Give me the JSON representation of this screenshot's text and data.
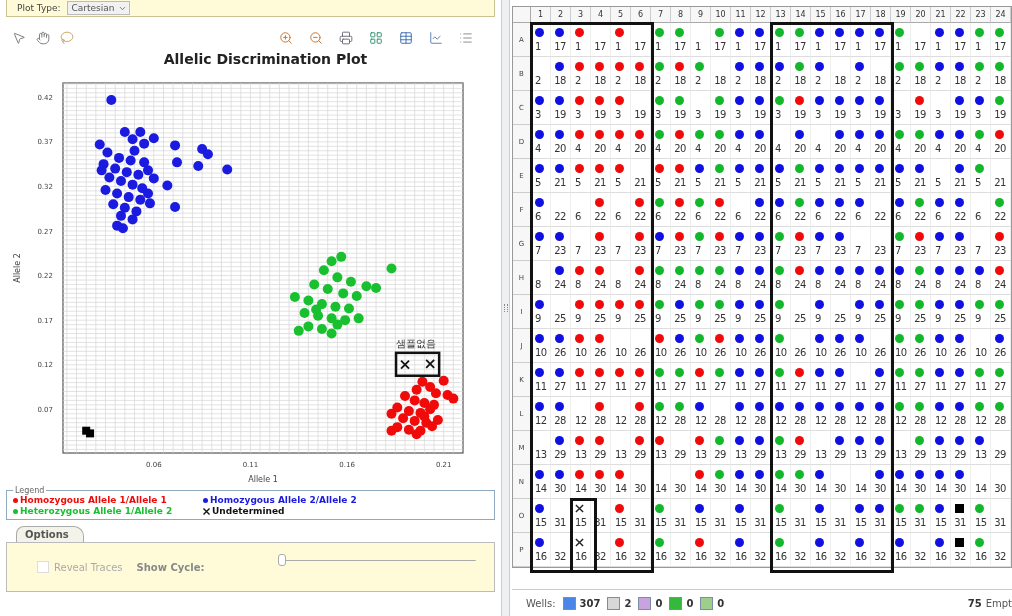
{
  "plot_type": {
    "label": "Plot Type:",
    "value": "Cartesian"
  },
  "plot": {
    "title": "Allelic Discrimination Plot",
    "chart_data": {
      "type": "scatter",
      "grid": true,
      "xlabel": "Allele 1",
      "ylabel": "Allele 2",
      "xlim": [
        0.013,
        0.22
      ],
      "ylim": [
        0.021,
        0.436
      ],
      "xticks": [
        0.06,
        0.11,
        0.16,
        0.21
      ],
      "yticks": [
        0.07,
        0.12,
        0.17,
        0.22,
        0.27,
        0.32,
        0.37,
        0.42
      ],
      "series": [
        {
          "name": "Homozygous Allele 1/Allele 1",
          "color": "#f00a0a",
          "marker": "circle",
          "x": [
            0.199,
            0.203,
            0.21,
            0.206,
            0.212,
            0.215,
            0.196,
            0.19,
            0.195,
            0.2,
            0.205,
            0.186,
            0.192,
            0.198,
            0.203,
            0.183,
            0.189,
            0.195,
            0.201,
            0.207,
            0.186,
            0.192,
            0.198,
            0.204,
            0.183,
            0.196,
            0.2
          ],
          "values": [
            0.101,
            0.095,
            0.102,
            0.088,
            0.086,
            0.082,
            0.092,
            0.085,
            0.08,
            0.077,
            0.075,
            0.072,
            0.068,
            0.066,
            0.07,
            0.065,
            0.06,
            0.057,
            0.055,
            0.058,
            0.05,
            0.047,
            0.046,
            0.051,
            0.046,
            0.042,
            0.062
          ]
        },
        {
          "name": "Homozygous Allele 2/Allele 2",
          "color": "#1a1ae0",
          "marker": "circle",
          "x": [
            0.038,
            0.045,
            0.053,
            0.06,
            0.049,
            0.055,
            0.032,
            0.071,
            0.085,
            0.088,
            0.072,
            0.083,
            0.098,
            0.06,
            0.067,
            0.071,
            0.036,
            0.042,
            0.048,
            0.055,
            0.034,
            0.04,
            0.046,
            0.052,
            0.057,
            0.037,
            0.043,
            0.049,
            0.054,
            0.035,
            0.041,
            0.047,
            0.053,
            0.058,
            0.039,
            0.045,
            0.051,
            0.043,
            0.049,
            0.041,
            0.044,
            0.057,
            0.033,
            0.05
          ],
          "values": [
            0.417,
            0.381,
            0.381,
            0.374,
            0.373,
            0.368,
            0.367,
            0.366,
            0.362,
            0.356,
            0.347,
            0.343,
            0.339,
            0.329,
            0.321,
            0.297,
            0.358,
            0.352,
            0.349,
            0.347,
            0.345,
            0.34,
            0.336,
            0.333,
            0.338,
            0.33,
            0.326,
            0.322,
            0.318,
            0.316,
            0.312,
            0.308,
            0.305,
            0.301,
            0.3,
            0.296,
            0.292,
            0.287,
            0.283,
            0.276,
            0.273,
            0.312,
            0.338,
            0.36
          ]
        },
        {
          "name": "Heterozygous Allele 1/Allele 2",
          "color": "#18c030",
          "marker": "circle",
          "x": [
            0.157,
            0.152,
            0.183,
            0.148,
            0.155,
            0.162,
            0.17,
            0.175,
            0.143,
            0.15,
            0.158,
            0.165,
            0.133,
            0.14,
            0.147,
            0.154,
            0.161,
            0.138,
            0.145,
            0.152,
            0.159,
            0.166,
            0.14,
            0.147,
            0.135,
            0.152,
            0.155,
            0.144
          ],
          "values": [
            0.241,
            0.236,
            0.228,
            0.226,
            0.218,
            0.213,
            0.208,
            0.206,
            0.21,
            0.205,
            0.2,
            0.197,
            0.196,
            0.192,
            0.188,
            0.185,
            0.183,
            0.178,
            0.175,
            0.172,
            0.17,
            0.172,
            0.163,
            0.16,
            0.158,
            0.155,
            0.165,
            0.182
          ]
        },
        {
          "name": "Undetermined",
          "color": "#111111",
          "marker": "cross",
          "x": [
            0.19,
            0.203
          ],
          "values": [
            0.12,
            0.121
          ]
        },
        {
          "color": "#000000",
          "marker": "square",
          "x": [
            0.025,
            0.027
          ],
          "values": [
            0.046,
            0.043
          ]
        }
      ],
      "annotations": [
        {
          "text": "샘플없음"
        }
      ]
    }
  },
  "legend": {
    "title": "Legend"
  },
  "options": {
    "tab": "Options",
    "reveal_traces": {
      "label": "Reveal Traces",
      "checked": false,
      "disabled": true
    },
    "show_cycle": {
      "label": "Show Cycle:",
      "level": 0
    }
  },
  "plate": {
    "columns": [
      "1",
      "2",
      "3",
      "4",
      "5",
      "6",
      "7",
      "8",
      "9",
      "10",
      "11",
      "12",
      "13",
      "14",
      "15",
      "16",
      "17",
      "18",
      "19",
      "20",
      "21",
      "22",
      "23",
      "24"
    ],
    "rows": [
      {
        "label": "A",
        "wells": [
          {
            "label": "1",
            "kind": "allele2"
          },
          {
            "label": "17",
            "kind": "allele2"
          },
          {
            "label": "1",
            "kind": "allele1"
          },
          {
            "label": "17",
            "kind": "empty"
          },
          {
            "label": "1",
            "kind": "allele1"
          },
          {
            "label": "17",
            "kind": "empty"
          },
          {
            "label": "1",
            "kind": "hetero"
          },
          {
            "label": "17",
            "kind": "hetero"
          },
          {
            "label": "1",
            "kind": "empty"
          },
          {
            "label": "17",
            "kind": "hetero"
          },
          {
            "label": "1",
            "kind": "allele2"
          },
          {
            "label": "17",
            "kind": "allele2"
          },
          {
            "label": "1",
            "kind": "hetero"
          },
          {
            "label": "17",
            "kind": "hetero"
          },
          {
            "label": "1",
            "kind": "allele2"
          },
          {
            "label": "17",
            "kind": "allele2"
          },
          {
            "label": "1",
            "kind": "allele2"
          },
          {
            "label": "17",
            "kind": "allele2"
          },
          {
            "label": "1",
            "kind": "hetero"
          },
          {
            "label": "17",
            "kind": "empty"
          },
          {
            "label": "1",
            "kind": "allele2"
          },
          {
            "label": "17",
            "kind": "allele2"
          },
          {
            "label": "1",
            "kind": "hetero"
          },
          {
            "label": "17",
            "kind": "hetero"
          }
        ]
      },
      {
        "label": "B",
        "wells": [
          {
            "label": "2",
            "kind": "empty"
          },
          {
            "label": "18",
            "kind": "allele2"
          },
          {
            "label": "2",
            "kind": "allele1"
          },
          {
            "label": "18",
            "kind": "allele1"
          },
          {
            "label": "2",
            "kind": "allele1"
          },
          {
            "label": "18",
            "kind": "allele1"
          },
          {
            "label": "2",
            "kind": "hetero"
          },
          {
            "label": "18",
            "kind": "allele1"
          },
          {
            "label": "2",
            "kind": "hetero"
          },
          {
            "label": "18",
            "kind": "empty"
          },
          {
            "label": "2",
            "kind": "allele2"
          },
          {
            "label": "18",
            "kind": "allele2"
          },
          {
            "label": "2",
            "kind": "allele2"
          },
          {
            "label": "18",
            "kind": "hetero"
          },
          {
            "label": "2",
            "kind": "allele2"
          },
          {
            "label": "18",
            "kind": "empty"
          },
          {
            "label": "2",
            "kind": "allele2"
          },
          {
            "label": "18",
            "kind": "empty"
          },
          {
            "label": "2",
            "kind": "hetero"
          },
          {
            "label": "18",
            "kind": "hetero"
          },
          {
            "label": "2",
            "kind": "allele2"
          },
          {
            "label": "18",
            "kind": "allele2"
          },
          {
            "label": "2",
            "kind": "hetero"
          },
          {
            "label": "18",
            "kind": "hetero"
          }
        ]
      },
      {
        "label": "C",
        "wells": [
          {
            "label": "3",
            "kind": "allele2"
          },
          {
            "label": "19",
            "kind": "allele2"
          },
          {
            "label": "3",
            "kind": "allele1"
          },
          {
            "label": "19",
            "kind": "allele1"
          },
          {
            "label": "3",
            "kind": "allele1"
          },
          {
            "label": "19",
            "kind": "empty"
          },
          {
            "label": "3",
            "kind": "hetero"
          },
          {
            "label": "19",
            "kind": "hetero"
          },
          {
            "label": "3",
            "kind": "empty"
          },
          {
            "label": "19",
            "kind": "hetero"
          },
          {
            "label": "3",
            "kind": "allele2"
          },
          {
            "label": "19",
            "kind": "allele2"
          },
          {
            "label": "3",
            "kind": "hetero"
          },
          {
            "label": "19",
            "kind": "allele1"
          },
          {
            "label": "3",
            "kind": "allele2"
          },
          {
            "label": "19",
            "kind": "allele2"
          },
          {
            "label": "3",
            "kind": "allele2"
          },
          {
            "label": "19",
            "kind": "allele2"
          },
          {
            "label": "3",
            "kind": "empty"
          },
          {
            "label": "19",
            "kind": "allele1"
          },
          {
            "label": "3",
            "kind": "empty"
          },
          {
            "label": "19",
            "kind": "allele2"
          },
          {
            "label": "3",
            "kind": "allele2"
          },
          {
            "label": "19",
            "kind": "hetero"
          }
        ]
      },
      {
        "label": "D",
        "wells": [
          {
            "label": "4",
            "kind": "allele2"
          },
          {
            "label": "20",
            "kind": "allele2"
          },
          {
            "label": "4",
            "kind": "allele1"
          },
          {
            "label": "20",
            "kind": "allele1"
          },
          {
            "label": "4",
            "kind": "allele1"
          },
          {
            "label": "20",
            "kind": "allele1"
          },
          {
            "label": "4",
            "kind": "hetero"
          },
          {
            "label": "20",
            "kind": "allele1"
          },
          {
            "label": "4",
            "kind": "hetero"
          },
          {
            "label": "20",
            "kind": "hetero"
          },
          {
            "label": "4",
            "kind": "allele2"
          },
          {
            "label": "20",
            "kind": "allele2"
          },
          {
            "label": "4",
            "kind": "empty"
          },
          {
            "label": "20",
            "kind": "allele2"
          },
          {
            "label": "4",
            "kind": "empty"
          },
          {
            "label": "20",
            "kind": "allele2"
          },
          {
            "label": "4",
            "kind": "allele2"
          },
          {
            "label": "20",
            "kind": "allele2"
          },
          {
            "label": "4",
            "kind": "hetero"
          },
          {
            "label": "20",
            "kind": "hetero"
          },
          {
            "label": "4",
            "kind": "allele2"
          },
          {
            "label": "20",
            "kind": "allele2"
          },
          {
            "label": "4",
            "kind": "hetero"
          },
          {
            "label": "20",
            "kind": "allele1"
          }
        ]
      },
      {
        "label": "E",
        "wells": [
          {
            "label": "5",
            "kind": "allele2"
          },
          {
            "label": "21",
            "kind": "allele2"
          },
          {
            "label": "5",
            "kind": "allele1"
          },
          {
            "label": "21",
            "kind": "allele1"
          },
          {
            "label": "5",
            "kind": "allele1"
          },
          {
            "label": "21",
            "kind": "empty"
          },
          {
            "label": "5",
            "kind": "allele1"
          },
          {
            "label": "21",
            "kind": "allele1"
          },
          {
            "label": "5",
            "kind": "allele2"
          },
          {
            "label": "21",
            "kind": "hetero"
          },
          {
            "label": "5",
            "kind": "allele2"
          },
          {
            "label": "21",
            "kind": "allele2"
          },
          {
            "label": "5",
            "kind": "allele2"
          },
          {
            "label": "21",
            "kind": "hetero"
          },
          {
            "label": "5",
            "kind": "allele2"
          },
          {
            "label": "21",
            "kind": "allele2"
          },
          {
            "label": "5",
            "kind": "allele2"
          },
          {
            "label": "21",
            "kind": "allele2"
          },
          {
            "label": "5",
            "kind": "allele2"
          },
          {
            "label": "21",
            "kind": "allele2"
          },
          {
            "label": "5",
            "kind": "empty"
          },
          {
            "label": "21",
            "kind": "allele2"
          },
          {
            "label": "5",
            "kind": "hetero"
          },
          {
            "label": "21",
            "kind": "empty"
          }
        ]
      },
      {
        "label": "F",
        "wells": [
          {
            "label": "6",
            "kind": "allele2"
          },
          {
            "label": "22",
            "kind": "empty"
          },
          {
            "label": "6",
            "kind": "empty"
          },
          {
            "label": "22",
            "kind": "allele1"
          },
          {
            "label": "6",
            "kind": "empty"
          },
          {
            "label": "22",
            "kind": "allele1"
          },
          {
            "label": "6",
            "kind": "hetero"
          },
          {
            "label": "22",
            "kind": "allele1"
          },
          {
            "label": "6",
            "kind": "hetero"
          },
          {
            "label": "22",
            "kind": "allele1"
          },
          {
            "label": "6",
            "kind": "empty"
          },
          {
            "label": "22",
            "kind": "allele2"
          },
          {
            "label": "6",
            "kind": "allele2"
          },
          {
            "label": "22",
            "kind": "hetero"
          },
          {
            "label": "6",
            "kind": "allele2"
          },
          {
            "label": "22",
            "kind": "allele2"
          },
          {
            "label": "6",
            "kind": "allele2"
          },
          {
            "label": "22",
            "kind": "empty"
          },
          {
            "label": "6",
            "kind": "allele2"
          },
          {
            "label": "22",
            "kind": "hetero"
          },
          {
            "label": "6",
            "kind": "allele2"
          },
          {
            "label": "22",
            "kind": "allele2"
          },
          {
            "label": "6",
            "kind": "empty"
          },
          {
            "label": "22",
            "kind": "hetero"
          }
        ]
      },
      {
        "label": "G",
        "wells": [
          {
            "label": "7",
            "kind": "allele2"
          },
          {
            "label": "23",
            "kind": "allele2"
          },
          {
            "label": "7",
            "kind": "empty"
          },
          {
            "label": "23",
            "kind": "allele1"
          },
          {
            "label": "7",
            "kind": "empty"
          },
          {
            "label": "23",
            "kind": "allele1"
          },
          {
            "label": "7",
            "kind": "allele2"
          },
          {
            "label": "23",
            "kind": "allele1"
          },
          {
            "label": "7",
            "kind": "hetero"
          },
          {
            "label": "23",
            "kind": "allele1"
          },
          {
            "label": "7",
            "kind": "allele2"
          },
          {
            "label": "23",
            "kind": "allele2"
          },
          {
            "label": "7",
            "kind": "hetero"
          },
          {
            "label": "23",
            "kind": "allele1"
          },
          {
            "label": "7",
            "kind": "allele2"
          },
          {
            "label": "23",
            "kind": "allele2"
          },
          {
            "label": "7",
            "kind": "empty"
          },
          {
            "label": "23",
            "kind": "empty"
          },
          {
            "label": "7",
            "kind": "hetero"
          },
          {
            "label": "23",
            "kind": "allele1"
          },
          {
            "label": "7",
            "kind": "allele2"
          },
          {
            "label": "23",
            "kind": "allele2"
          },
          {
            "label": "7",
            "kind": "empty"
          },
          {
            "label": "23",
            "kind": "allele1"
          }
        ]
      },
      {
        "label": "H",
        "wells": [
          {
            "label": "8",
            "kind": "empty"
          },
          {
            "label": "24",
            "kind": "allele2"
          },
          {
            "label": "8",
            "kind": "allele1"
          },
          {
            "label": "24",
            "kind": "allele1"
          },
          {
            "label": "8",
            "kind": "empty"
          },
          {
            "label": "24",
            "kind": "allele1"
          },
          {
            "label": "8",
            "kind": "hetero"
          },
          {
            "label": "24",
            "kind": "hetero"
          },
          {
            "label": "8",
            "kind": "hetero"
          },
          {
            "label": "24",
            "kind": "hetero"
          },
          {
            "label": "8",
            "kind": "allele2"
          },
          {
            "label": "24",
            "kind": "allele2"
          },
          {
            "label": "8",
            "kind": "hetero"
          },
          {
            "label": "24",
            "kind": "allele1"
          },
          {
            "label": "8",
            "kind": "allele2"
          },
          {
            "label": "24",
            "kind": "allele2"
          },
          {
            "label": "8",
            "kind": "allele2"
          },
          {
            "label": "24",
            "kind": "allele2"
          },
          {
            "label": "8",
            "kind": "allele2"
          },
          {
            "label": "24",
            "kind": "hetero"
          },
          {
            "label": "8",
            "kind": "allele2"
          },
          {
            "label": "24",
            "kind": "allele2"
          },
          {
            "label": "8",
            "kind": "allele2"
          },
          {
            "label": "24",
            "kind": "allele1"
          }
        ]
      },
      {
        "label": "I",
        "wells": [
          {
            "label": "9",
            "kind": "allele2"
          },
          {
            "label": "25",
            "kind": "empty"
          },
          {
            "label": "9",
            "kind": "allele1"
          },
          {
            "label": "25",
            "kind": "allele1"
          },
          {
            "label": "9",
            "kind": "allele1"
          },
          {
            "label": "25",
            "kind": "allele1"
          },
          {
            "label": "9",
            "kind": "hetero"
          },
          {
            "label": "25",
            "kind": "allele2"
          },
          {
            "label": "9",
            "kind": "hetero"
          },
          {
            "label": "25",
            "kind": "hetero"
          },
          {
            "label": "9",
            "kind": "allele2"
          },
          {
            "label": "25",
            "kind": "allele2"
          },
          {
            "label": "9",
            "kind": "hetero"
          },
          {
            "label": "25",
            "kind": "empty"
          },
          {
            "label": "9",
            "kind": "allele2"
          },
          {
            "label": "25",
            "kind": "empty"
          },
          {
            "label": "9",
            "kind": "allele2"
          },
          {
            "label": "25",
            "kind": "allele2"
          },
          {
            "label": "9",
            "kind": "hetero"
          },
          {
            "label": "25",
            "kind": "hetero"
          },
          {
            "label": "9",
            "kind": "allele2"
          },
          {
            "label": "25",
            "kind": "allele2"
          },
          {
            "label": "9",
            "kind": "hetero"
          },
          {
            "label": "25",
            "kind": "hetero"
          }
        ]
      },
      {
        "label": "J",
        "wells": [
          {
            "label": "10",
            "kind": "allele2"
          },
          {
            "label": "26",
            "kind": "allele2"
          },
          {
            "label": "10",
            "kind": "allele1"
          },
          {
            "label": "26",
            "kind": "allele1"
          },
          {
            "label": "10",
            "kind": "empty"
          },
          {
            "label": "26",
            "kind": "empty"
          },
          {
            "label": "10",
            "kind": "allele1"
          },
          {
            "label": "26",
            "kind": "allele2"
          },
          {
            "label": "10",
            "kind": "hetero"
          },
          {
            "label": "26",
            "kind": "allele1"
          },
          {
            "label": "10",
            "kind": "allele2"
          },
          {
            "label": "26",
            "kind": "allele2"
          },
          {
            "label": "10",
            "kind": "hetero"
          },
          {
            "label": "26",
            "kind": "empty"
          },
          {
            "label": "10",
            "kind": "allele2"
          },
          {
            "label": "26",
            "kind": "allele2"
          },
          {
            "label": "10",
            "kind": "allele2"
          },
          {
            "label": "26",
            "kind": "empty"
          },
          {
            "label": "10",
            "kind": "hetero"
          },
          {
            "label": "26",
            "kind": "hetero"
          },
          {
            "label": "10",
            "kind": "allele2"
          },
          {
            "label": "26",
            "kind": "allele2"
          },
          {
            "label": "10",
            "kind": "empty"
          },
          {
            "label": "26",
            "kind": "allele2"
          }
        ]
      },
      {
        "label": "K",
        "wells": [
          {
            "label": "11",
            "kind": "allele2"
          },
          {
            "label": "27",
            "kind": "allele2"
          },
          {
            "label": "11",
            "kind": "allele1"
          },
          {
            "label": "27",
            "kind": "allele1"
          },
          {
            "label": "11",
            "kind": "allele1"
          },
          {
            "label": "27",
            "kind": "allele1"
          },
          {
            "label": "11",
            "kind": "hetero"
          },
          {
            "label": "27",
            "kind": "hetero"
          },
          {
            "label": "11",
            "kind": "allele1"
          },
          {
            "label": "27",
            "kind": "hetero"
          },
          {
            "label": "11",
            "kind": "allele2"
          },
          {
            "label": "27",
            "kind": "allele2"
          },
          {
            "label": "11",
            "kind": "hetero"
          },
          {
            "label": "27",
            "kind": "allele1"
          },
          {
            "label": "11",
            "kind": "allele2"
          },
          {
            "label": "27",
            "kind": "allele2"
          },
          {
            "label": "11",
            "kind": "empty"
          },
          {
            "label": "27",
            "kind": "allele2"
          },
          {
            "label": "11",
            "kind": "hetero"
          },
          {
            "label": "27",
            "kind": "hetero"
          },
          {
            "label": "11",
            "kind": "allele2"
          },
          {
            "label": "27",
            "kind": "allele2"
          },
          {
            "label": "11",
            "kind": "hetero"
          },
          {
            "label": "27",
            "kind": "hetero"
          }
        ]
      },
      {
        "label": "L",
        "wells": [
          {
            "label": "12",
            "kind": "allele2"
          },
          {
            "label": "28",
            "kind": "allele2"
          },
          {
            "label": "12",
            "kind": "empty"
          },
          {
            "label": "28",
            "kind": "allele1"
          },
          {
            "label": "12",
            "kind": "empty"
          },
          {
            "label": "28",
            "kind": "allele1"
          },
          {
            "label": "12",
            "kind": "hetero"
          },
          {
            "label": "28",
            "kind": "hetero"
          },
          {
            "label": "12",
            "kind": "allele2"
          },
          {
            "label": "28",
            "kind": "empty"
          },
          {
            "label": "12",
            "kind": "allele2"
          },
          {
            "label": "28",
            "kind": "allele2"
          },
          {
            "label": "12",
            "kind": "allele2"
          },
          {
            "label": "28",
            "kind": "allele2"
          },
          {
            "label": "12",
            "kind": "allele2"
          },
          {
            "label": "28",
            "kind": "allele2"
          },
          {
            "label": "12",
            "kind": "allele2"
          },
          {
            "label": "28",
            "kind": "allele2"
          },
          {
            "label": "12",
            "kind": "hetero"
          },
          {
            "label": "28",
            "kind": "hetero"
          },
          {
            "label": "12",
            "kind": "allele2"
          },
          {
            "label": "28",
            "kind": "allele2"
          },
          {
            "label": "12",
            "kind": "hetero"
          },
          {
            "label": "28",
            "kind": "hetero"
          }
        ]
      },
      {
        "label": "M",
        "wells": [
          {
            "label": "13",
            "kind": "empty"
          },
          {
            "label": "29",
            "kind": "allele2"
          },
          {
            "label": "13",
            "kind": "allele1"
          },
          {
            "label": "29",
            "kind": "allele1"
          },
          {
            "label": "13",
            "kind": "empty"
          },
          {
            "label": "29",
            "kind": "allele1"
          },
          {
            "label": "13",
            "kind": "allele1"
          },
          {
            "label": "29",
            "kind": "empty"
          },
          {
            "label": "13",
            "kind": "allele1"
          },
          {
            "label": "29",
            "kind": "hetero"
          },
          {
            "label": "13",
            "kind": "allele2"
          },
          {
            "label": "29",
            "kind": "allele2"
          },
          {
            "label": "13",
            "kind": "hetero"
          },
          {
            "label": "29",
            "kind": "allele1"
          },
          {
            "label": "13",
            "kind": "empty"
          },
          {
            "label": "29",
            "kind": "allele2"
          },
          {
            "label": "13",
            "kind": "allele2"
          },
          {
            "label": "29",
            "kind": "allele2"
          },
          {
            "label": "13",
            "kind": "empty"
          },
          {
            "label": "29",
            "kind": "hetero"
          },
          {
            "label": "13",
            "kind": "allele2"
          },
          {
            "label": "29",
            "kind": "allele2"
          },
          {
            "label": "13",
            "kind": "allele2"
          },
          {
            "label": "29",
            "kind": "empty"
          }
        ]
      },
      {
        "label": "N",
        "wells": [
          {
            "label": "14",
            "kind": "allele2"
          },
          {
            "label": "30",
            "kind": "allele2"
          },
          {
            "label": "14",
            "kind": "allele1"
          },
          {
            "label": "30",
            "kind": "allele1"
          },
          {
            "label": "14",
            "kind": "allele1"
          },
          {
            "label": "30",
            "kind": "empty"
          },
          {
            "label": "14",
            "kind": "empty"
          },
          {
            "label": "30",
            "kind": "empty"
          },
          {
            "label": "14",
            "kind": "allele1"
          },
          {
            "label": "30",
            "kind": "hetero"
          },
          {
            "label": "14",
            "kind": "allele2"
          },
          {
            "label": "30",
            "kind": "allele2"
          },
          {
            "label": "14",
            "kind": "hetero"
          },
          {
            "label": "30",
            "kind": "hetero"
          },
          {
            "label": "14",
            "kind": "allele2"
          },
          {
            "label": "30",
            "kind": "empty"
          },
          {
            "label": "14",
            "kind": "empty"
          },
          {
            "label": "30",
            "kind": "allele2"
          },
          {
            "label": "14",
            "kind": "allele2"
          },
          {
            "label": "30",
            "kind": "allele2"
          },
          {
            "label": "14",
            "kind": "allele2"
          },
          {
            "label": "30",
            "kind": "allele2"
          },
          {
            "label": "14",
            "kind": "empty"
          },
          {
            "label": "30",
            "kind": "empty"
          }
        ]
      },
      {
        "label": "O",
        "wells": [
          {
            "label": "15",
            "kind": "allele2"
          },
          {
            "label": "31",
            "kind": "empty"
          },
          {
            "label": "15",
            "kind": "undetermined"
          },
          {
            "label": "31",
            "kind": "empty"
          },
          {
            "label": "15",
            "kind": "allele1"
          },
          {
            "label": "31",
            "kind": "empty"
          },
          {
            "label": "15",
            "kind": "hetero"
          },
          {
            "label": "31",
            "kind": "empty"
          },
          {
            "label": "15",
            "kind": "allele2"
          },
          {
            "label": "31",
            "kind": "empty"
          },
          {
            "label": "15",
            "kind": "allele2"
          },
          {
            "label": "31",
            "kind": "empty"
          },
          {
            "label": "15",
            "kind": "hetero"
          },
          {
            "label": "31",
            "kind": "empty"
          },
          {
            "label": "15",
            "kind": "allele2"
          },
          {
            "label": "31",
            "kind": "empty"
          },
          {
            "label": "15",
            "kind": "allele2"
          },
          {
            "label": "31",
            "kind": "allele2"
          },
          {
            "label": "15",
            "kind": "hetero"
          },
          {
            "label": "31",
            "kind": "hetero"
          },
          {
            "label": "15",
            "kind": "allele2"
          },
          {
            "label": "31",
            "kind": "control"
          },
          {
            "label": "15",
            "kind": "hetero"
          },
          {
            "label": "31",
            "kind": "empty"
          }
        ]
      },
      {
        "label": "P",
        "wells": [
          {
            "label": "16",
            "kind": "allele2"
          },
          {
            "label": "32",
            "kind": "empty"
          },
          {
            "label": "16",
            "kind": "undetermined"
          },
          {
            "label": "32",
            "kind": "empty"
          },
          {
            "label": "16",
            "kind": "allele1"
          },
          {
            "label": "32",
            "kind": "empty"
          },
          {
            "label": "16",
            "kind": "hetero"
          },
          {
            "label": "32",
            "kind": "empty"
          },
          {
            "label": "16",
            "kind": "allele1"
          },
          {
            "label": "32",
            "kind": "empty"
          },
          {
            "label": "16",
            "kind": "allele2"
          },
          {
            "label": "32",
            "kind": "empty"
          },
          {
            "label": "16",
            "kind": "hetero"
          },
          {
            "label": "32",
            "kind": "empty"
          },
          {
            "label": "16",
            "kind": "allele2"
          },
          {
            "label": "32",
            "kind": "empty"
          },
          {
            "label": "16",
            "kind": "allele2"
          },
          {
            "label": "32",
            "kind": "empty"
          },
          {
            "label": "16",
            "kind": "allele2"
          },
          {
            "label": "32",
            "kind": "empty"
          },
          {
            "label": "16",
            "kind": "allele2"
          },
          {
            "label": "32",
            "kind": "control"
          },
          {
            "label": "16",
            "kind": "hetero"
          },
          {
            "label": "32",
            "kind": "empty"
          }
        ]
      }
    ]
  },
  "status_bar": {
    "label": "Wells:",
    "counts": [
      {
        "kind": "unknown",
        "count": "307"
      },
      {
        "kind": "ntc",
        "count": "2"
      },
      {
        "kind": "standard",
        "count": "0"
      },
      {
        "kind": "ipc",
        "count": "0"
      },
      {
        "kind": "blocked",
        "count": "0"
      }
    ],
    "empty_count": "75",
    "empty_label": "Empt"
  }
}
